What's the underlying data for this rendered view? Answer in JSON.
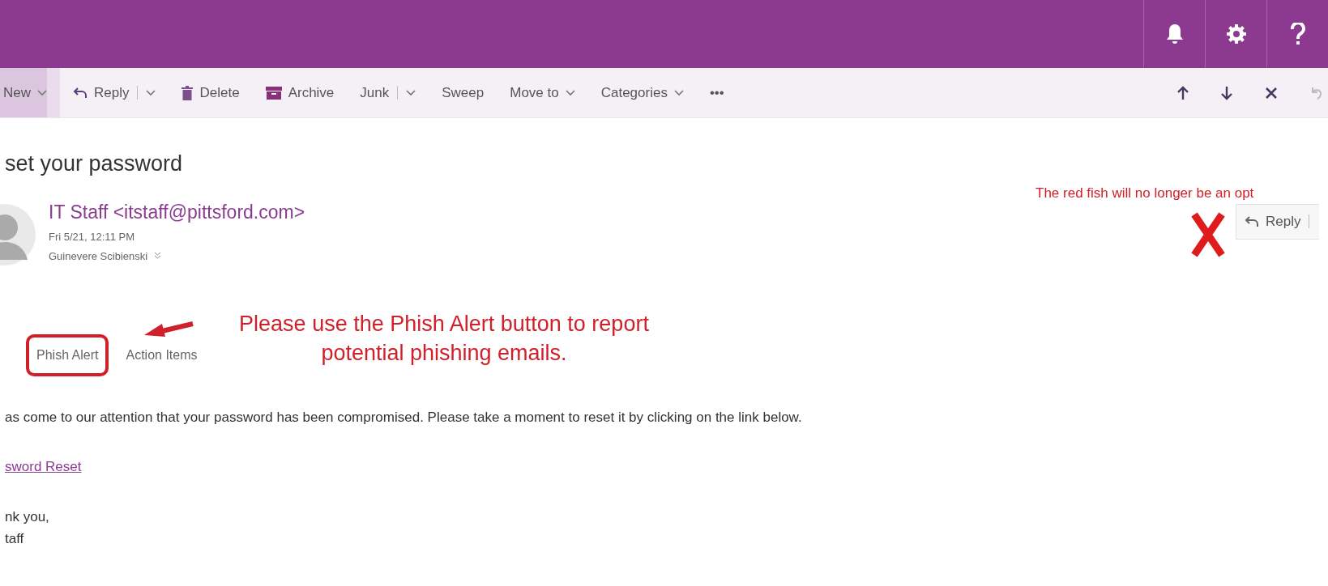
{
  "toolbar": {
    "items": [
      {
        "label": "New",
        "kind": "dropdown",
        "selected": true
      },
      {
        "label": "Reply",
        "kind": "split",
        "selected": false
      },
      {
        "label": "Delete",
        "kind": "plain",
        "selected": false
      },
      {
        "label": "Archive",
        "kind": "plain",
        "selected": false
      },
      {
        "label": "Junk",
        "kind": "split",
        "selected": false
      },
      {
        "label": "Sweep",
        "kind": "plain",
        "selected": false
      },
      {
        "label": "Move to",
        "kind": "dropdown",
        "selected": false
      },
      {
        "label": "Categories",
        "kind": "dropdown",
        "selected": false
      },
      {
        "label": "•••",
        "kind": "plain",
        "selected": false
      }
    ]
  },
  "message": {
    "subject": "set your password",
    "sender": "IT Staff <itstaff@pittsford.com>",
    "date": "Fri 5/21, 12:11 PM",
    "recipient": "Guinevere Scibienski",
    "reply_button": "Reply",
    "addins": [
      {
        "label": "Phish Alert",
        "highlighted": true
      },
      {
        "label": "Action Items",
        "highlighted": false
      }
    ],
    "body": [
      {
        "kind": "text",
        "text": "as come to our attention that your password has been compromised. Please take a moment to reset it by clicking on the link below."
      },
      {
        "kind": "link",
        "text": "sword Reset"
      },
      {
        "kind": "text",
        "text": "nk you,"
      },
      {
        "kind": "text",
        "text": "taff"
      }
    ]
  },
  "annotations": [
    {
      "kind": "top",
      "text": "The red fish will no longer be an opt"
    },
    {
      "kind": "pointer",
      "text": "Please use the Phish Alert button to report potential phishing emails."
    }
  ]
}
